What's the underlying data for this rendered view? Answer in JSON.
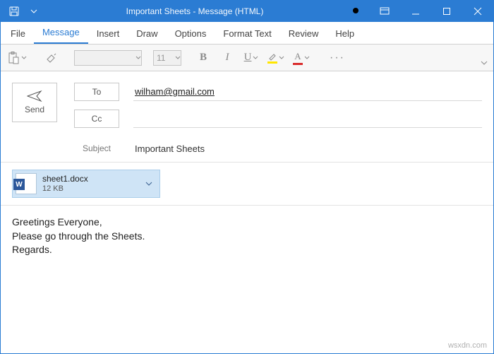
{
  "titlebar": {
    "title": "Important Sheets  -  Message (HTML)"
  },
  "tabs": {
    "file": "File",
    "message": "Message",
    "insert": "Insert",
    "draw": "Draw",
    "options": "Options",
    "format_text": "Format Text",
    "review": "Review",
    "help": "Help"
  },
  "ribbon": {
    "font_size": "11",
    "bold": "B",
    "italic": "I",
    "underline": "U",
    "highlight_color": "#ffe600",
    "font_color": "#d92b2b",
    "more": "···"
  },
  "compose": {
    "send": "Send",
    "to_btn": "To",
    "cc_btn": "Cc",
    "subject_label": "Subject",
    "to_value": "wilham@gmail.com",
    "cc_value": "",
    "subject_value": "Important Sheets"
  },
  "attachment": {
    "badge": "W",
    "name": "sheet1.docx",
    "size": "12 KB"
  },
  "body": {
    "text": "Greetings Everyone,\nPlease go through the Sheets.\nRegards."
  },
  "watermark": "wsxdn.com"
}
